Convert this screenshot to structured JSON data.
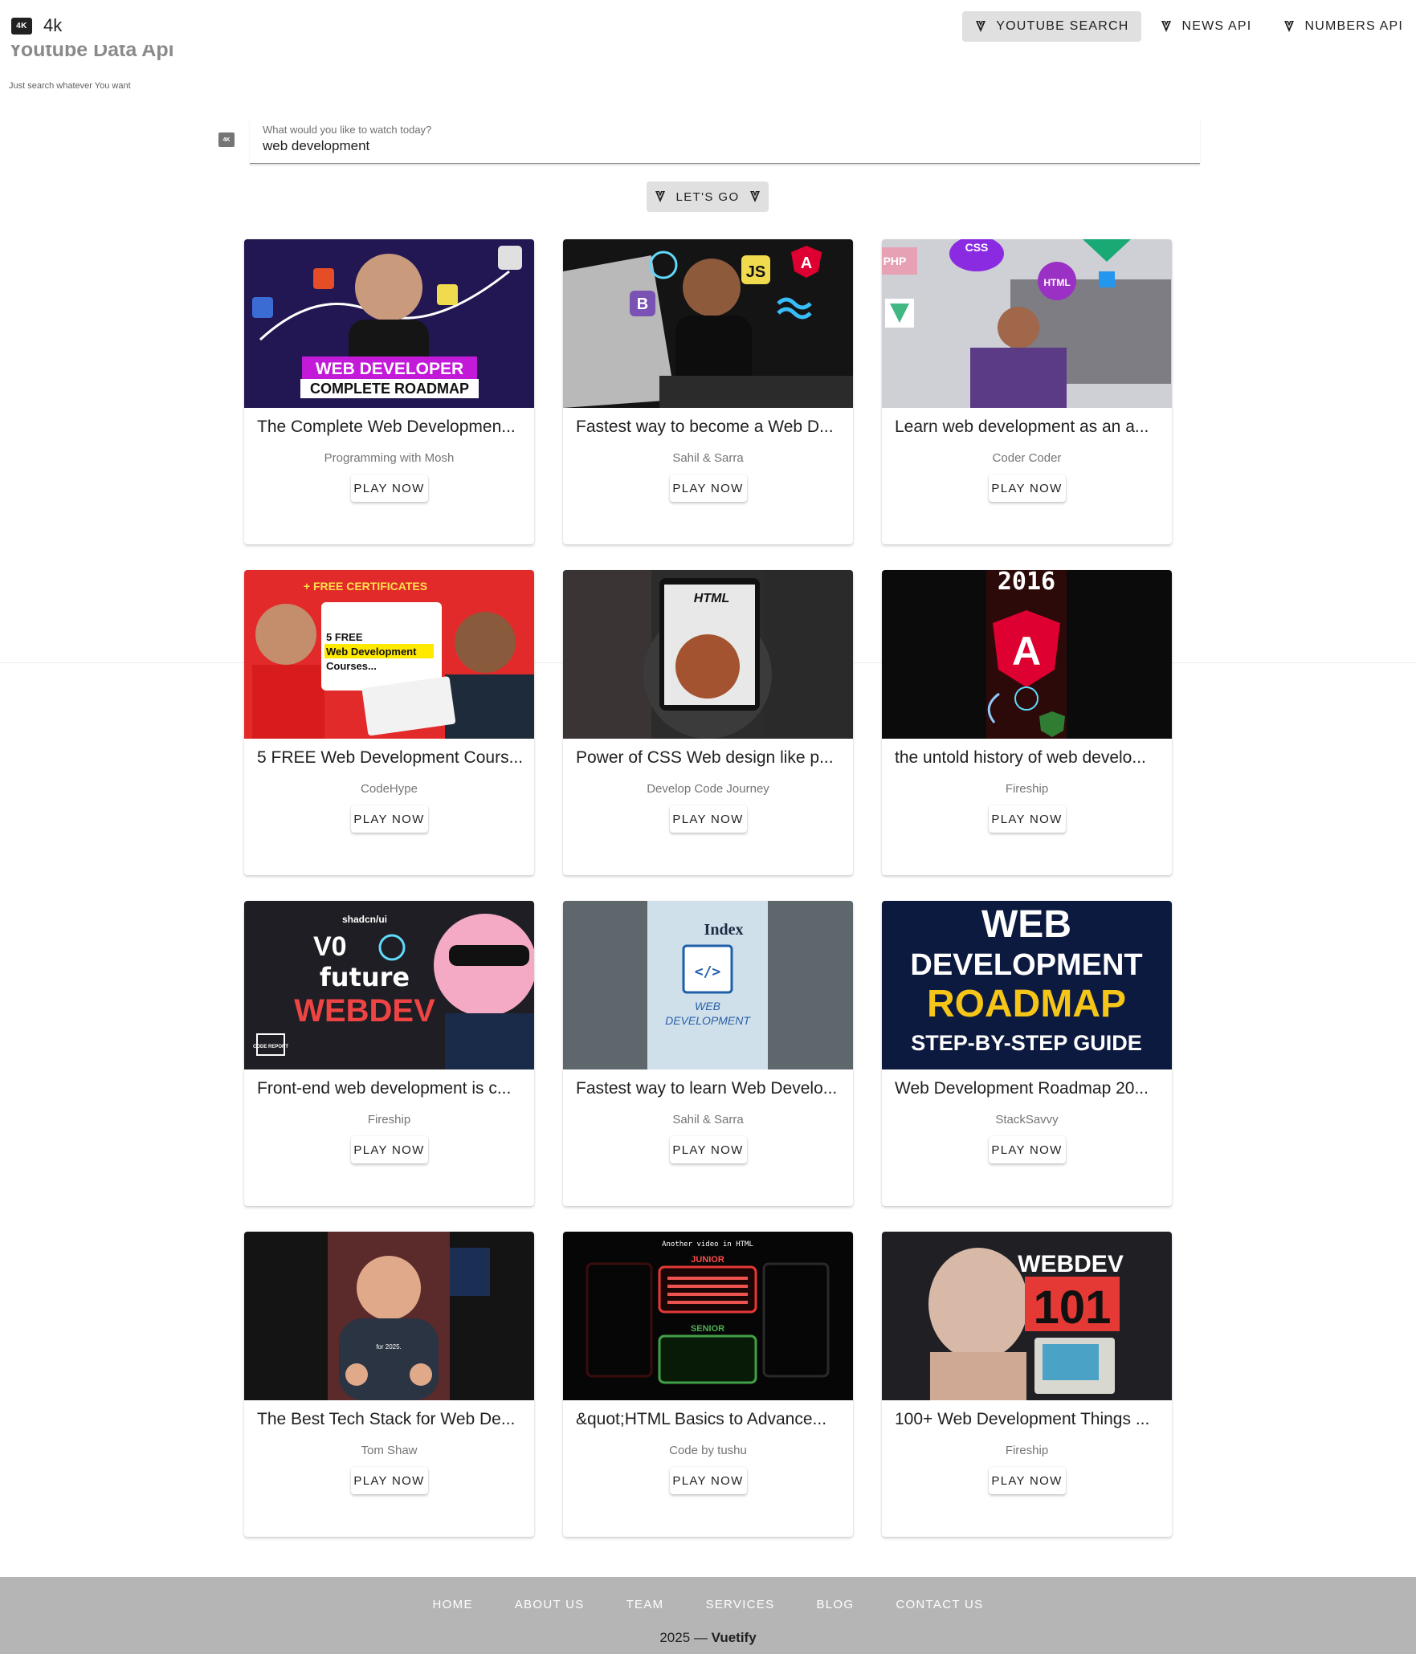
{
  "app": {
    "logo_text": "4K",
    "title": "4k"
  },
  "nav": {
    "items": [
      {
        "label": "YOUTUBE SEARCH",
        "icon": "vuetify-icon"
      },
      {
        "label": "NEWS API",
        "icon": "vuetify-icon"
      },
      {
        "label": "NUMBERS API",
        "icon": "vuetify-icon"
      }
    ]
  },
  "hero": {
    "title": "Youtube Data Api",
    "subtitle": "Just search whatever You want"
  },
  "search": {
    "icon_text": "4K",
    "label": "What would you like to watch today?",
    "value": "web development",
    "button_label": "LET'S GO"
  },
  "play_label": "PLAY NOW",
  "videos": [
    {
      "title": "The Complete Web Developmen...",
      "channel": "Programming with Mosh",
      "thumb_text": [
        "WEB DEVELOPER",
        "COMPLETE ROADMAP"
      ]
    },
    {
      "title": "Fastest way to become a Web D...",
      "channel": "Sahil & Sarra",
      "thumb_text": [
        "JS",
        "A",
        "B"
      ]
    },
    {
      "title": "Learn web development as an a...",
      "channel": "Coder Coder",
      "thumb_text": [
        "PHP",
        "CSS",
        "HTML"
      ]
    },
    {
      "title": "5 FREE Web Development Cours...",
      "channel": "CodeHype",
      "thumb_text": [
        "+ FREE CERTIFICATES",
        "5 FREE",
        "Web Development",
        "Courses..."
      ]
    },
    {
      "title": "Power of CSS Web design like p...",
      "channel": "Develop Code Journey",
      "thumb_text": [
        "HTML"
      ]
    },
    {
      "title": "the untold history of web develo...",
      "channel": "Fireship",
      "thumb_text": [
        "2016",
        "A"
      ]
    },
    {
      "title": "Front-end web development is c...",
      "channel": "Fireship",
      "thumb_text": [
        "shadcn/ui",
        "future",
        "WEBDEV",
        "CODE REPORT"
      ]
    },
    {
      "title": "Fastest way to learn Web Develo...",
      "channel": "Sahil & Sarra",
      "thumb_text": [
        "WEB",
        "DEVELOPMENT",
        "Index"
      ]
    },
    {
      "title": "Web Development Roadmap 20...",
      "channel": "StackSavvy",
      "thumb_text": [
        "WEB",
        "DEVELOPMENT",
        "ROADMAP",
        "STEP-BY-STEP GUIDE"
      ]
    },
    {
      "title": "The Best Tech Stack for Web De...",
      "channel": "Tom Shaw",
      "thumb_text": [
        "for 2025."
      ]
    },
    {
      "title": "&quot;HTML Basics to Advance...",
      "channel": "Code by tushu",
      "thumb_text": [
        "Another video in HTML",
        "JUNIOR",
        "SENIOR"
      ]
    },
    {
      "title": "100+ Web Development Things ...",
      "channel": "Fireship",
      "thumb_text": [
        "WEBDEV",
        "101"
      ]
    }
  ],
  "footer": {
    "links": [
      "HOME",
      "ABOUT US",
      "TEAM",
      "SERVICES",
      "BLOG",
      "CONTACT US"
    ],
    "year": "2025",
    "dash": "—",
    "brand": "Vuetify"
  }
}
